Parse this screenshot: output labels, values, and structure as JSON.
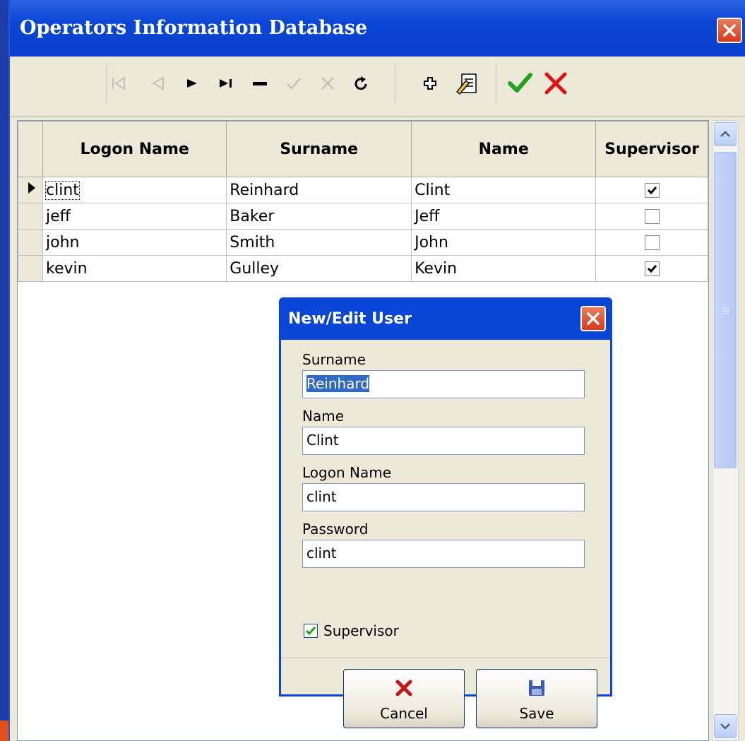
{
  "window": {
    "title": "Operators Information Database"
  },
  "toolbar": {
    "buttons": [
      "first-record",
      "prior-record",
      "next-record",
      "last-record",
      "delete-record",
      "post-edit",
      "cancel-edit",
      "refresh",
      "insert-record",
      "edit-record",
      "confirm",
      "cancel"
    ]
  },
  "grid": {
    "columns": [
      "Logon Name",
      "Surname",
      "Name",
      "Supervisor"
    ],
    "rows": [
      {
        "logon": "clint",
        "surname": "Reinhard",
        "name": "Clint",
        "supervisor": true
      },
      {
        "logon": "jeff",
        "surname": "Baker",
        "name": "Jeff",
        "supervisor": false
      },
      {
        "logon": "john",
        "surname": "Smith",
        "name": "John",
        "supervisor": false
      },
      {
        "logon": "kevin",
        "surname": "Gulley",
        "name": "Kevin",
        "supervisor": true
      }
    ]
  },
  "dialog": {
    "title": "New/Edit User",
    "surname_label": "Surname",
    "surname_value": "Reinhard",
    "name_label": "Name",
    "name_value": "Clint",
    "logon_label": "Logon Name",
    "logon_value": "clint",
    "password_label": "Password",
    "password_value": "clint",
    "supervisor_label": "Supervisor",
    "supervisor_checked": true,
    "cancel_label": "Cancel",
    "save_label": "Save"
  },
  "colors": {
    "titlebar": "#0a46d6",
    "window_bg": "#ece9d8",
    "close_red": "#d7381b",
    "check_green": "#21a121"
  }
}
